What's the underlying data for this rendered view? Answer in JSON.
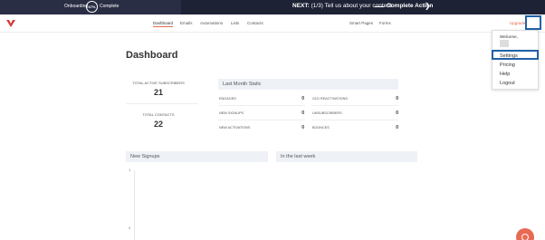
{
  "onboarding": {
    "label": "Onboarding",
    "percent": "67%",
    "complete": "Complete",
    "next_prefix": "NEXT:",
    "next_step": "(1/3) Tell us about your content",
    "action": "Complete Action",
    "colors": {
      "bar": "#1e2235",
      "accent": "#ffffff"
    }
  },
  "nav": {
    "items": [
      {
        "label": "Dashboard"
      },
      {
        "label": "Emails"
      },
      {
        "label": "Automations"
      },
      {
        "label": "Lists"
      },
      {
        "label": "Contacts"
      }
    ],
    "right_items": [
      {
        "label": "Smart Pages"
      },
      {
        "label": "Forms"
      }
    ],
    "upgrade": "Upgrade"
  },
  "dropdown": {
    "welcome": "Welcome,",
    "items": [
      {
        "label": "Settings"
      },
      {
        "label": "Pricing"
      },
      {
        "label": "Help"
      },
      {
        "label": "Logout"
      }
    ]
  },
  "page": {
    "title": "Dashboard"
  },
  "stats": {
    "active_label": "TOTAL ACTIVE SUBSCRIBERS",
    "active_value": "21",
    "contacts_label": "TOTAL CONTACTS",
    "contacts_value": "22"
  },
  "last_month": {
    "title": "Last Month Static",
    "metrics": [
      {
        "label": "ENGAGED",
        "value": "0"
      },
      {
        "label": "OLD REACTIVATIONS",
        "value": "0"
      },
      {
        "label": "NEW SIGNUPS",
        "value": "0"
      },
      {
        "label": "UNSUBSCRIBERS",
        "value": "0"
      },
      {
        "label": "NEW ACTIVATIONS",
        "value": "0"
      },
      {
        "label": "BOUNCES",
        "value": "0"
      }
    ]
  },
  "signups": {
    "title": "New Signups",
    "period": "In the last week",
    "y_top": "1",
    "y_bottom": "0"
  },
  "colors": {
    "accent": "#e86a55",
    "highlight": "#2160a8",
    "panel": "#eef1f6"
  }
}
